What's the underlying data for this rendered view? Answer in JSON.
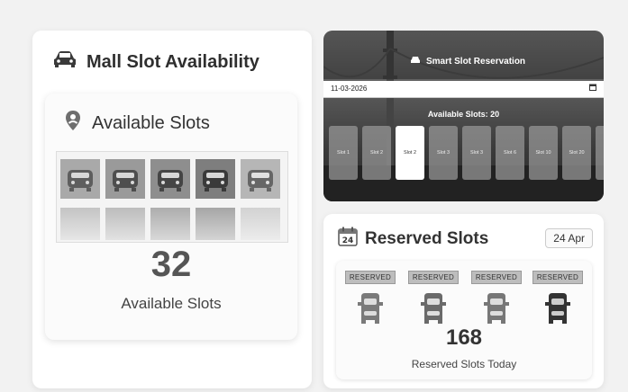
{
  "left_panel": {
    "title": "Mall Slot Availability",
    "card_title": "Available Slots",
    "count": "32",
    "count_label": "Available Slots"
  },
  "reservation_panel": {
    "title": "Smart Slot Reservation",
    "date": "11-03-2026",
    "available_label": "Available Slots: 20",
    "slots": [
      "Slot 1",
      "Slot 2",
      "Slot 2",
      "Slot 3",
      "Slot 3",
      "Slot 6",
      "Slot 10",
      "Slot 20",
      "Sl"
    ],
    "selected_index": 2
  },
  "reserved_panel": {
    "title": "Reserved Slots",
    "date_badge": "24 Apr",
    "calendar_day": "24",
    "badges": [
      "RESERVED",
      "RESERVED",
      "RESERVED",
      "RESERVED"
    ],
    "count": "168",
    "count_label": "Reserved Slots Today"
  },
  "colors": {
    "page_bg": "#f2f2f2",
    "card_bg": "#ffffff",
    "text_dark": "#333333",
    "badge_bg": "#bdbdbd"
  }
}
